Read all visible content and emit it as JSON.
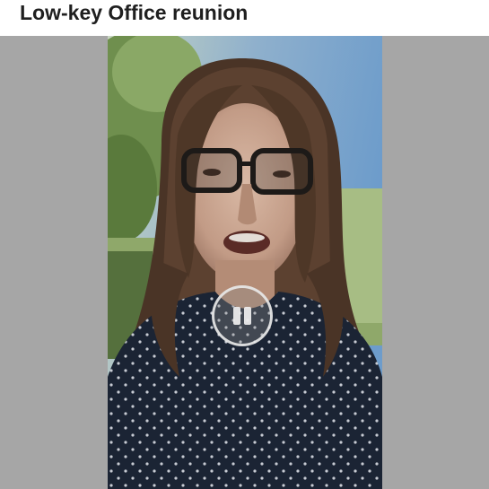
{
  "post": {
    "title": "Low-key Office reunion"
  },
  "video": {
    "state": "playing",
    "control_icon": "pause-icon",
    "background_color": "#a6a6a6"
  }
}
